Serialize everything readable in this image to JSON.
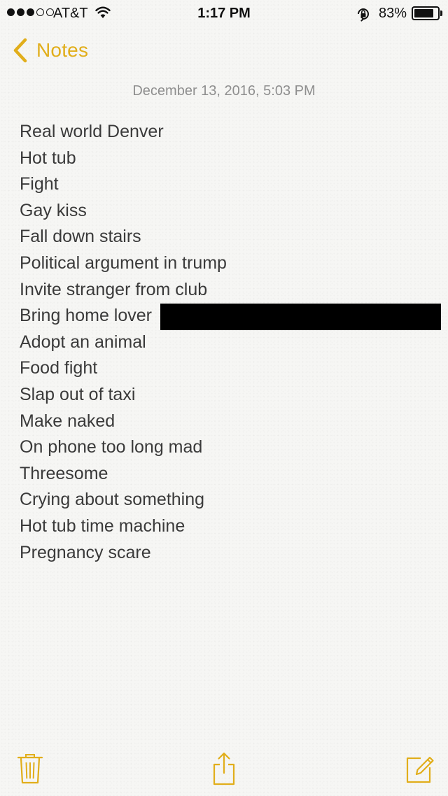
{
  "status_bar": {
    "carrier": "AT&T",
    "time": "1:17 PM",
    "battery_percent": "83%",
    "battery_level": 0.83,
    "signal_bars_filled": 3,
    "signal_bars_total": 5,
    "icons": [
      "signal-dots-icon",
      "wifi-icon",
      "rotation-lock-icon",
      "battery-icon"
    ]
  },
  "nav": {
    "back_label": "Notes",
    "back_icon": "chevron-left-icon"
  },
  "note": {
    "date": "December 13, 2016, 5:03 PM",
    "lines": [
      "Real world Denver",
      "Hot tub",
      "Fight",
      "Gay kiss",
      "Fall down stairs",
      "Political argument in trump",
      "Invite stranger from club",
      "Bring home lover",
      "Adopt an animal",
      "Food fight",
      "Slap out of taxi",
      "Make naked",
      "On phone too long mad",
      "Threesome",
      "Crying about something",
      "Hot tub time machine",
      "Pregnancy scare"
    ]
  },
  "toolbar": {
    "icons": [
      "trash-icon",
      "share-icon",
      "compose-icon"
    ]
  },
  "colors": {
    "accent": "#e1ae1b",
    "text": "#3a3a3a",
    "date_text": "#8e8e8e",
    "paper": "#f6f6f4"
  }
}
